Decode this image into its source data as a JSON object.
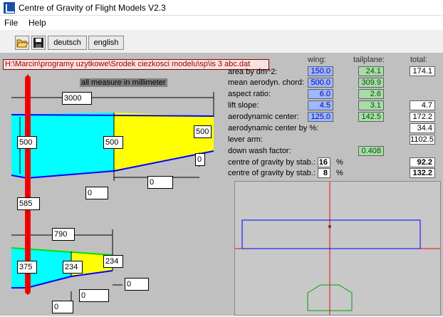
{
  "window": {
    "title": "Centre of Gravity of Flight Models V2.3"
  },
  "menu": {
    "file": "File",
    "help": "Help"
  },
  "toolbar": {
    "open_icon": "folder-open-icon",
    "save_icon": "floppy-disk-icon",
    "deutsch": "deutsch",
    "english": "english"
  },
  "path": "H:\\Marcin\\programy uzytkowe\\Srodek ciezkosci modelu\\sp\\is 3 abc.dat",
  "drawing": {
    "note": "all measure in millimeter",
    "span_wing": "3000",
    "wing_root": "500",
    "wing_mid": "500",
    "wing_tip": "500",
    "wing_tip_offset": "0",
    "wing_sweep": "0",
    "wing_root_offset": "0",
    "lever": "585",
    "span_tail": "790",
    "tail_root": "375",
    "tail_mid": "234",
    "tail_tip": "234",
    "tail_tip_offset": "0",
    "tail_sweep": "0",
    "tail_root_offset": "0"
  },
  "table": {
    "headers": {
      "wing": "wing:",
      "tail": "tailplane:",
      "total": "total:"
    },
    "rows": [
      {
        "label": "area by dm^2:",
        "wing": "150.0",
        "tail": "24.1",
        "total": "174.1"
      },
      {
        "label": "mean aerodyn. chord:",
        "wing": "500.0",
        "tail": "309.9",
        "total": ""
      },
      {
        "label": "aspect ratio:",
        "wing": "6.0",
        "tail": "2.6",
        "total": ""
      },
      {
        "label": "lift slope:",
        "wing": "4.5",
        "tail": "3.1",
        "total": "4.7"
      },
      {
        "label": "aerodynamic center:",
        "wing": "125.0",
        "tail": "142.5",
        "total": "172.2"
      },
      {
        "label": "aerodynamic center by %:",
        "wing": "",
        "tail": "",
        "total": "34.4"
      },
      {
        "label": "lever arm:",
        "wing": "",
        "tail": "",
        "total": "1102.5"
      },
      {
        "label": "down wash factor:",
        "wing": "",
        "tail": "0.408",
        "total": ""
      }
    ],
    "cg1": {
      "label": "centre of gravity by stab.:",
      "stab": "16",
      "unit": "%",
      "value": "92.2"
    },
    "cg2": {
      "label": "centre of gravity by stab.:",
      "stab": "8",
      "unit": "%",
      "value": "132.2"
    }
  },
  "colors": {
    "fuselage": "#ff0000",
    "wing_fill": "#00ffff",
    "flap_fill": "#ffff00",
    "outline_blue": "#0000ff",
    "outline_green": "#00e000"
  }
}
